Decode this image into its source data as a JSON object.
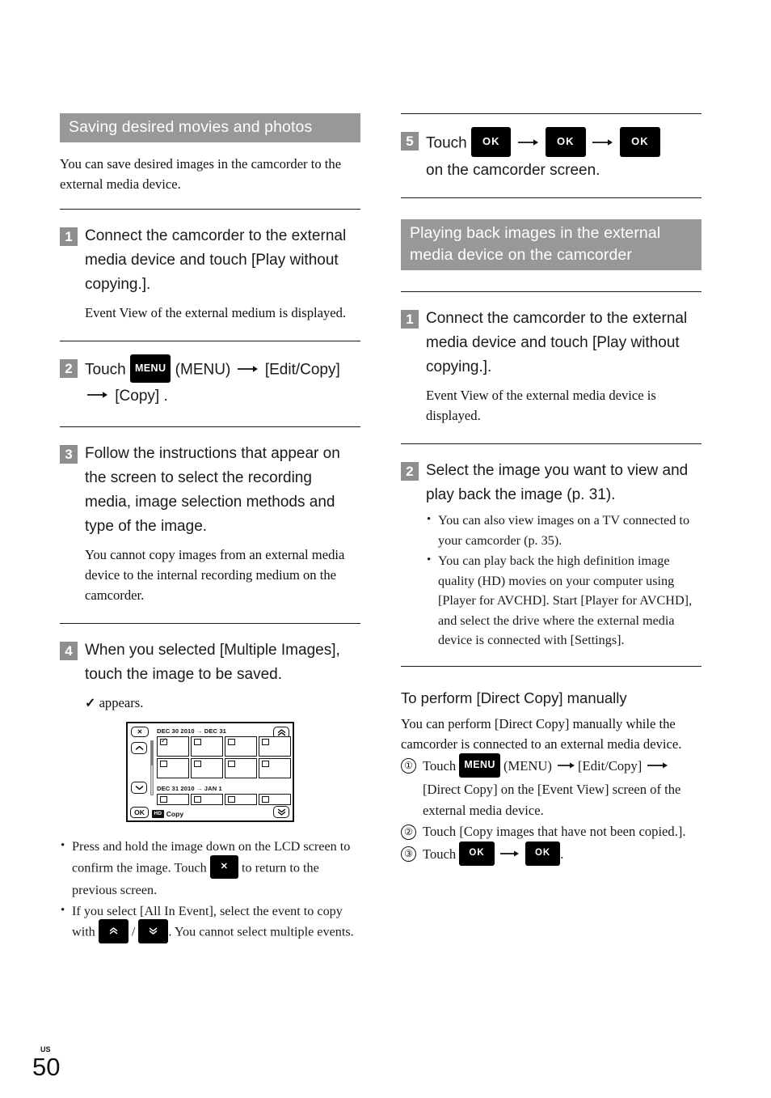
{
  "page": {
    "region_code": "US",
    "page_number": "50"
  },
  "left_column": {
    "section_header": "Saving desired movies and photos",
    "intro": "You can save desired images in the camcorder to the external media device.",
    "steps": [
      {
        "number": "1",
        "text": "Connect the camcorder to the external media device and touch [Play without copying.].",
        "note": "Event View of the external medium is displayed."
      },
      {
        "number": "2",
        "text_before": "Touch",
        "menu_button_label": "MENU",
        "text_after": "(MENU)",
        "target_1": "[Edit/Copy]",
        "target_2": "[Copy] ."
      },
      {
        "number": "3",
        "text": "Follow the instructions that appear on the screen to select the recording media, image selection methods and type of the image.",
        "note": "You cannot copy images from an external media device to the internal recording medium on the camcorder."
      },
      {
        "number": "4",
        "text": "When you selected [Multiple Images], touch the image to be saved.",
        "note_check": "appears."
      }
    ],
    "figure": {
      "close_button": "✕",
      "scroll_up_button": "⌃",
      "scroll_down_button": "⌄",
      "ok_button": "OK",
      "page_up_button": "«",
      "page_down_button": "»",
      "event_label_1": "DEC 30 2010 → DEC 31",
      "event_label_2": "DEC 31 2010 → JAN 1",
      "hd_badge": "HD",
      "copy_label": "Copy"
    },
    "bullets": [
      {
        "part1": "Press and hold the image down on the LCD screen to confirm the image. Touch",
        "button": "✕",
        "part2": "to return to the previous screen."
      },
      {
        "part1": "If you select [All In Event], select the event to copy with",
        "button_up": "«",
        "separator": "/",
        "button_down": "»",
        "part2": ". You cannot select multiple events."
      }
    ]
  },
  "right_column": {
    "step5": {
      "number": "5",
      "text_before": "Touch",
      "ok_1": "OK",
      "ok_2": "OK",
      "ok_3": "OK",
      "text_after": "on the camcorder screen."
    },
    "section_header": "Playing back images in the external media device on the camcorder",
    "steps": [
      {
        "number": "1",
        "text": "Connect the camcorder to the external media device and touch [Play without copying.].",
        "note": "Event View of the external media device is displayed."
      },
      {
        "number": "2",
        "text": "Select the image you want to view and play back the image (p. 31).",
        "bullets": [
          "You can also view images on a TV connected to your camcorder (p. 35).",
          "You can play back the high definition image quality (HD) movies on your computer using [Player for AVCHD]. Start [Player for AVCHD], and select the drive where the external media device is connected with [Settings]."
        ]
      }
    ],
    "direct_copy": {
      "heading": "To perform [Direct Copy] manually",
      "intro": "You can perform [Direct Copy] manually while the camcorder is connected to an external media device.",
      "items": [
        {
          "marker": "①",
          "text_before": "Touch",
          "menu_button_label": "MENU",
          "text_mid": "(MENU)",
          "target_1": "[Edit/Copy]",
          "target_2": "[Direct Copy] on the [Event View] screen of the external media device."
        },
        {
          "marker": "②",
          "text": "Touch [Copy images that have not been copied.]."
        },
        {
          "marker": "③",
          "text_before": "Touch",
          "ok_1": "OK",
          "ok_2": "OK",
          "text_after": "."
        }
      ]
    }
  },
  "colors": {
    "header_gray": "#989898",
    "step_num_gray": "#8e8e8e",
    "button_black": "#000000",
    "text": "#1a1a1a"
  }
}
